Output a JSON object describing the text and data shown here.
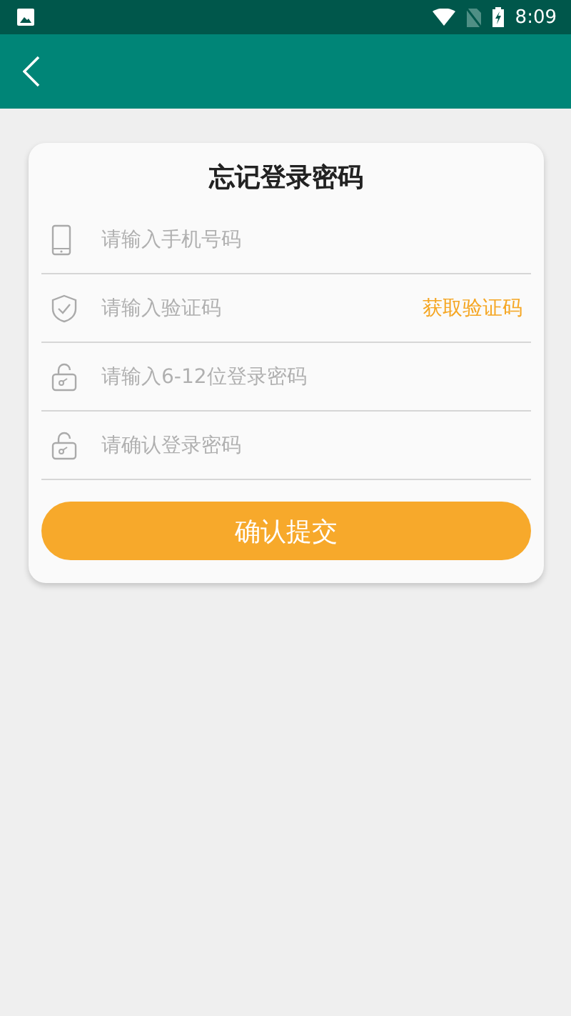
{
  "status_bar": {
    "time": "8:09"
  },
  "title": "忘记登录密码",
  "fields": [
    {
      "kind": "phone",
      "placeholder": "请输入手机号码"
    },
    {
      "kind": "code",
      "placeholder": "请输入验证码",
      "action": "获取验证码"
    },
    {
      "kind": "lock",
      "placeholder": "请输入6-12位登录密码"
    },
    {
      "kind": "lock",
      "placeholder": "请确认登录密码"
    }
  ],
  "submit": "确认提交"
}
